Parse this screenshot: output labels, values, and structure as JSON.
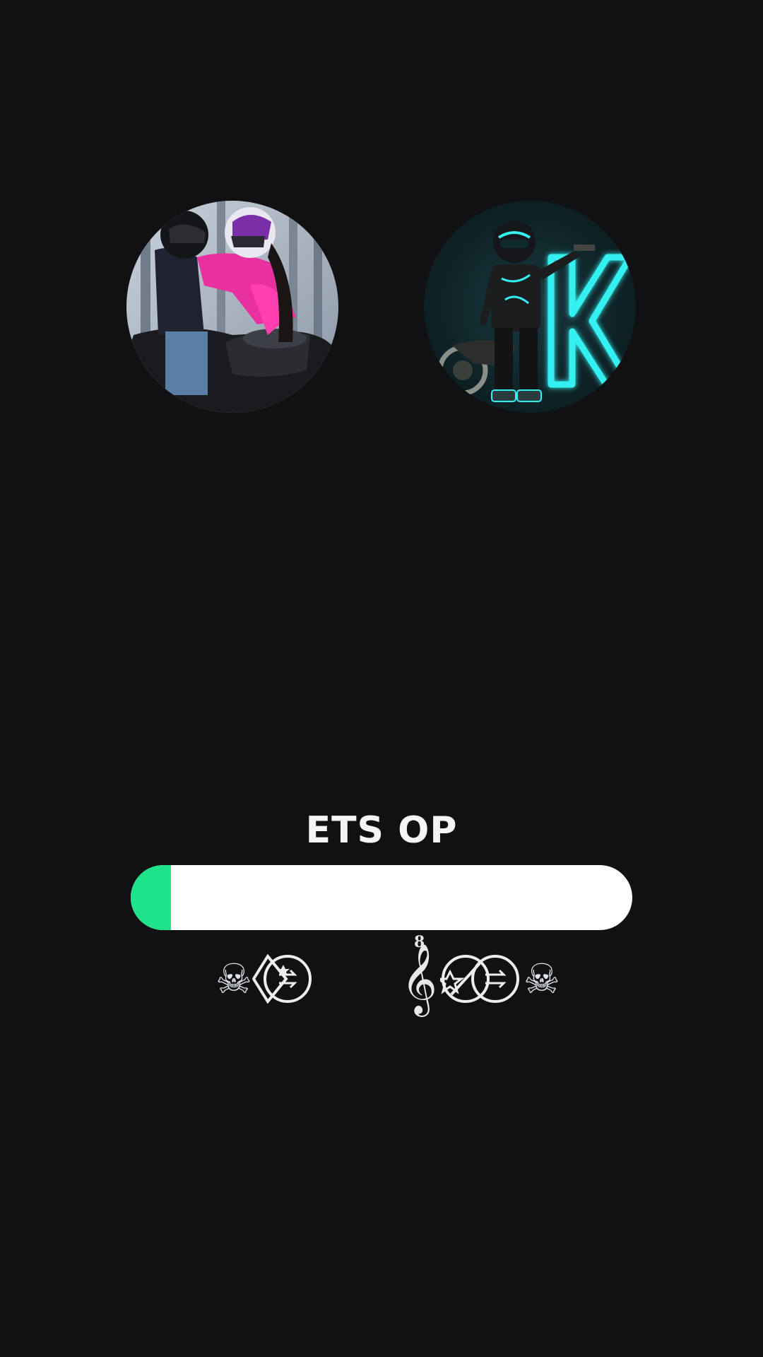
{
  "profile": {
    "title": "ETS OP"
  },
  "avatars": [
    {
      "name": "couple-on-motorcycle"
    },
    {
      "name": "neon-rider-letter-k",
      "letter": "K"
    }
  ],
  "progress": {
    "percent": 8,
    "fill_color": "#1ee38a",
    "track_color": "#ffffff"
  },
  "glyphs": {
    "left_skull": "☠",
    "right_skull": "☠",
    "clef": "𝄞",
    "clef_number": "8"
  },
  "colors": {
    "background": "#111013",
    "text": "#f5f5f5",
    "neon": "#35f0f0"
  }
}
